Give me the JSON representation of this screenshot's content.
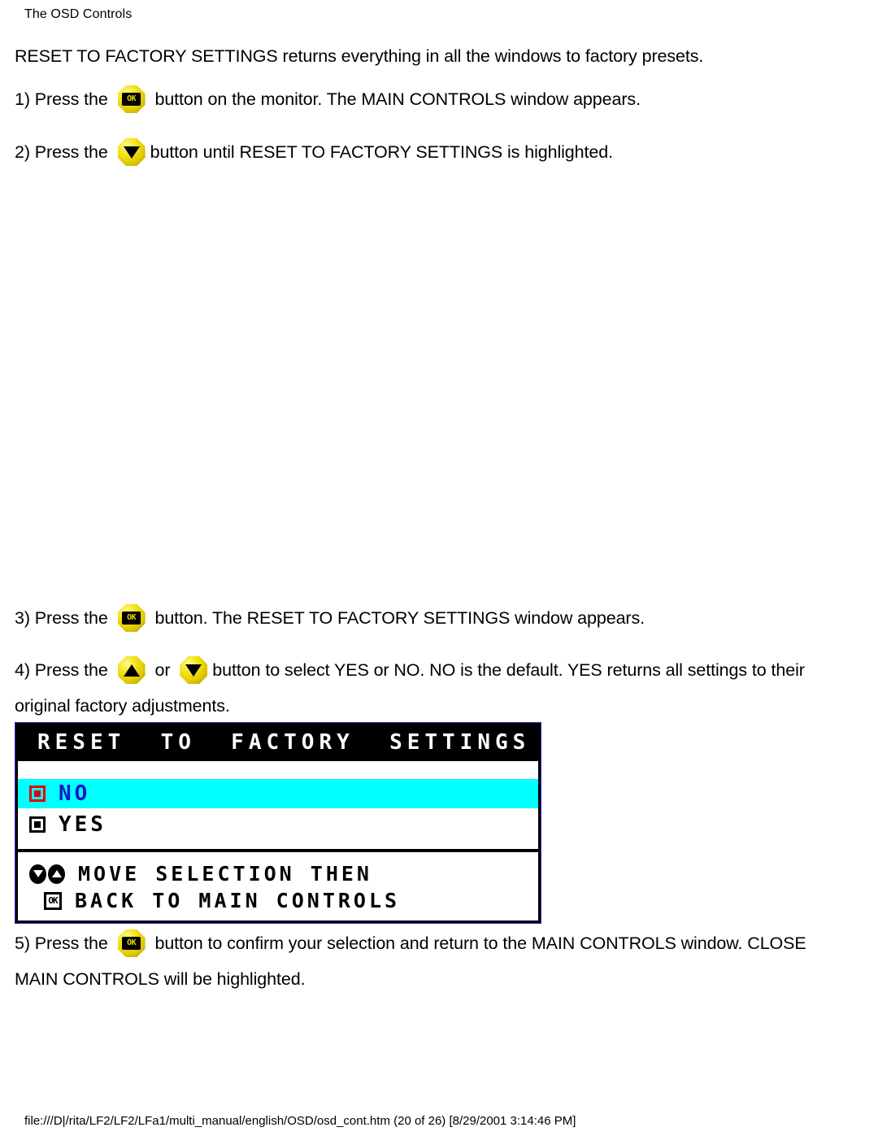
{
  "page": {
    "header_title": "The OSD Controls",
    "footer_path": "file:///D|/rita/LF2/LF2/LFa1/multi_manual/english/OSD/osd_cont.htm (20 of 26) [8/29/2001 3:14:46 PM]"
  },
  "intro": {
    "text": "RESET TO FACTORY SETTINGS returns everything in all the windows to factory presets."
  },
  "steps": [
    {
      "number": "1) Press the ",
      "icon": "ok-button-icon",
      "after": " button on the monitor. The MAIN CONTROLS window appears."
    },
    {
      "number": "2) Press the ",
      "icon": "down-arrow-button-icon",
      "after": "button until RESET TO FACTORY SETTINGS is highlighted."
    },
    {
      "number": "3) Press the ",
      "icon": "ok-button-icon",
      "after": " button. The RESET TO FACTORY SETTINGS window appears."
    },
    {
      "number": "4) Press the ",
      "icon": "up-arrow-button-icon",
      "middle": " or ",
      "icon2": "down-arrow-button-icon",
      "after": "button to select YES or NO. NO is the default. YES returns all settings to their",
      "line2": "original factory adjustments."
    },
    {
      "number": "5) Press the ",
      "icon": "ok-button-icon",
      "after": " button to confirm your selection and return to the MAIN CONTROLS window. CLOSE",
      "line2": "MAIN CONTROLS will be highlighted."
    }
  ],
  "osd": {
    "title": "RESET  TO  FACTORY  SETTINGS",
    "options": [
      {
        "label": "NO",
        "selected": true,
        "radio": "filled-red"
      },
      {
        "label": "YES",
        "selected": false,
        "radio": "filled-black"
      }
    ],
    "hints": [
      {
        "icons": [
          "down-arrow-icon",
          "up-arrow-icon"
        ],
        "text": "MOVE SELECTION THEN"
      },
      {
        "icons": [
          "ok-icon"
        ],
        "text": "BACK TO MAIN CONTROLS"
      }
    ],
    "ok_glyph": "OK",
    "colors": {
      "highlight": "#00ffff",
      "selected_text": "#1515c8",
      "radio_on": "#e40000",
      "title_bar": "#000000",
      "border": "#000000",
      "outline_blue": "#2b2bcf"
    }
  },
  "buttons": {
    "ok_glyph": "OK"
  }
}
